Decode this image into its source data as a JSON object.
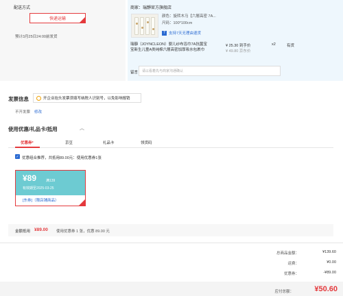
{
  "shipping": {
    "title": "配送方式",
    "method_label": "快递运输",
    "estimate": "预计3月25日24:00前发货"
  },
  "shop": {
    "name": "商家：瑞靜官方旗舰店"
  },
  "product": {
    "color": "颜色：旋转木马【六層高密 7A...",
    "size": "尺码：100*100cm",
    "service": "支持7天无理由退货",
    "service_icon": "7",
    "name_line1": "瑞靜（JOYNCLEON）婴儿纱布浴巾7A抗菌宝",
    "name_line2": "宝新生儿童A类纯棉六層高密加厚吸水包裹巾",
    "price": "¥ 25.30 到手价",
    "price_original": "¥ 49.80 京东价",
    "quantity": "x2",
    "stock": "有货"
  },
  "remark": {
    "label": "留言：",
    "placeholder": "请以看着先与商家沟通确认"
  },
  "invoice": {
    "title": "发票信息",
    "tip": "开企业抬头发票须填写纳税人识别号，以免影响报销",
    "status": "不开发票",
    "edit": "修改"
  },
  "coupons": {
    "title": "使用优惠/礼品卡/抵用",
    "caret": "︿",
    "tabs": [
      "优惠券",
      "京豆",
      "礼品卡",
      "领货码"
    ],
    "tab_badge": "*",
    "combo_text": "优惠组合推荐，共抵用89.00元：使用优惠券1张",
    "card": {
      "amount": "¥89",
      "condition": "满139",
      "valid": "有效期至2025-03-25",
      "tag": "[东券]（限店铺商品）"
    },
    "deduct_label": "金额抵用",
    "deduct_amount": "¥89.00",
    "deduct_detail": "使用优惠券 1 张，优惠 89.00 元"
  },
  "summary": {
    "total_label": "总商品金额：",
    "total_value": "¥139.60",
    "freight_label": "运费：",
    "freight_value": "¥0.00",
    "discount_label": "优惠券：",
    "discount_value": "-¥89.00",
    "pay_label": "应付总额：",
    "pay_value": "¥50.60"
  },
  "colors": {
    "accent": "#e4393c",
    "link": "#2a6ad2",
    "coupon_bg": "#6dcbd2"
  }
}
